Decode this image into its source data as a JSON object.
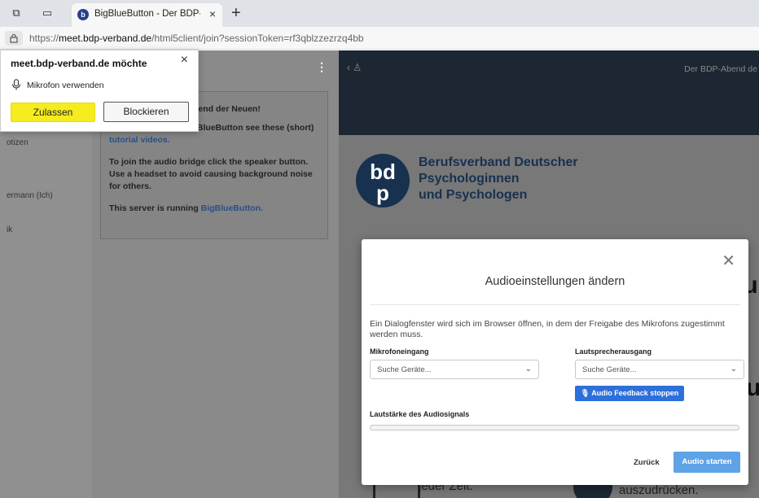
{
  "browser": {
    "tab_title": "BigBlueButton - Der BDP-Abend",
    "tab_favicon": "b",
    "url_scheme": "https://",
    "url_domain": "meet.bdp-verband.de",
    "url_path": "/html5client/join?sessionToken=rf3qblzzezrzq4bb"
  },
  "permission_popup": {
    "title": "meet.bdp-verband.de möchte",
    "permission": "Mikrofon verwenden",
    "allow_label": "Zulassen",
    "block_label": "Blockieren"
  },
  "userlist": {
    "items": [
      "otizen",
      "ermann (Ich)",
      "ik"
    ]
  },
  "chat": {
    "welcome_title_fragment": "bend der Neuen!",
    "help_fragment": "For help on using BigBlueButton see these (short)",
    "tutorial_link": "tutorial videos.",
    "audio_hint": "To join the audio bridge click the speaker button. Use a headset to avoid causing background noise for others.",
    "server_prefix": "This server is running",
    "server_link": "BigBlueButton."
  },
  "navbar": {
    "meeting_title": "Der BDP-Abend de"
  },
  "presentation": {
    "logo_line1": "Berufsverband Deutscher",
    "logo_line2": "Psychologinnen",
    "logo_line3": "und Psychologen",
    "bg_text_1": "jeder Zeit.",
    "bg_text_2": "auszudrücken.",
    "bg_frag_right1": "lu",
    "bg_frag_right2": "u"
  },
  "audio_modal": {
    "title": "Audioeinstellungen ändern",
    "description": "Ein Dialogfenster wird sich im Browser öffnen, in dem der Freigabe des Mikrofons zugestimmt werden muss.",
    "mic_label": "Mikrofoneingang",
    "mic_value": "Suche Geräte...",
    "speaker_label": "Lautsprecherausgang",
    "speaker_value": "Suche Geräte...",
    "feedback_button": "Audio Feedback stoppen",
    "level_label": "Lautstärke des Audiosignals",
    "level_fraction": 0,
    "back_label": "Zurück",
    "start_label": "Audio starten"
  }
}
